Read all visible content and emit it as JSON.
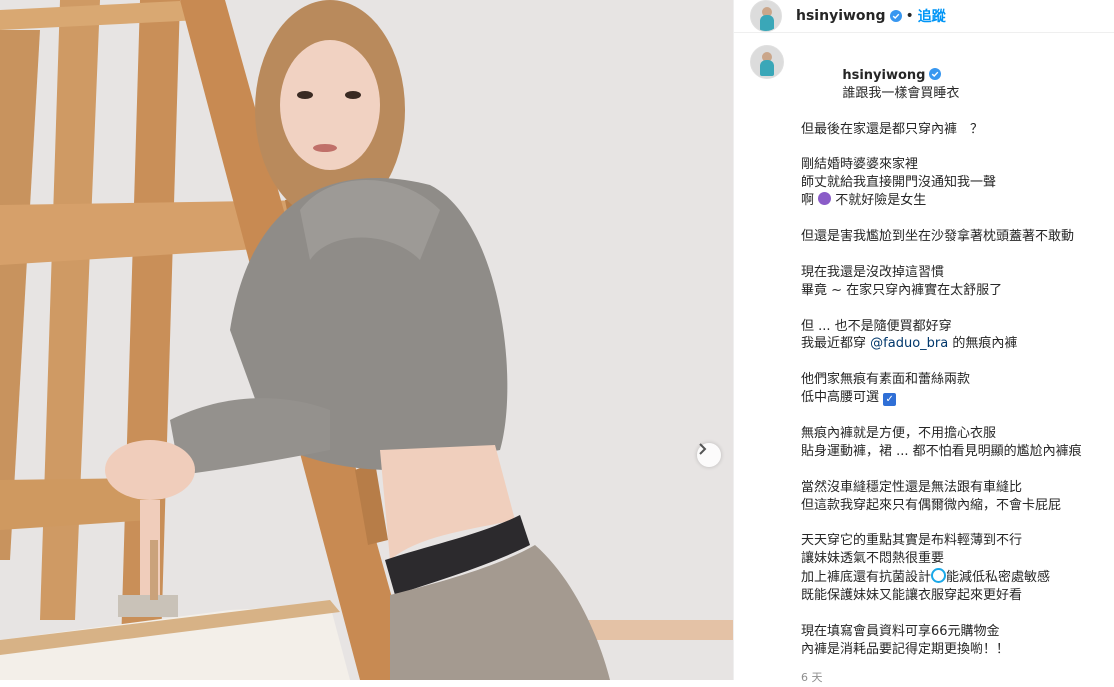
{
  "header": {
    "username": "hsinyiwong",
    "separator": "•",
    "follow_label": "追蹤"
  },
  "caption": {
    "username": "hsinyiwong",
    "first_line": "誰跟我一樣會買睡衣",
    "lines": [
      "但最後在家還是都只穿內褲　？",
      "",
      "剛結婚時婆婆來家裡",
      "師丈就給我直接開門沒通知我一聲",
      "啊",
      "",
      "但還是害我尷尬到坐在沙發拿著枕頭蓋著不敢動",
      "",
      "現在我還是沒改掉這習慣",
      "畢竟 ~ 在家只穿內褲實在太舒服了",
      "",
      "但 ... 也不是隨便買都好穿",
      "我最近都穿",
      "",
      "他們家無痕有素面和蕾絲兩款",
      "低中高腰可選",
      "",
      "無痕內褲就是方便，不用擔心衣服",
      "貼身運動褲，裙 ... 都不怕看見明顯的尷尬內褲痕",
      "",
      "當然沒車縫穩定性還是無法跟有車縫比",
      "但這款我穿起來只有偶爾微內縮，不會卡屁屁",
      "",
      "天天穿它的重點其實是布料輕薄到不行",
      "讓妹妹透氣不悶熱很重要",
      "加上褲底還有抗菌設計",
      "既能保護妹妹又能讓衣服穿起來更好看",
      "",
      "現在填寫會員資料可享66元購物金",
      "內褲是消耗品要記得定期更換喲！！"
    ],
    "ah_suffix": "不就好險是女生",
    "mention": "@faduo_bra",
    "mention_suffix": " 的無痕內褲",
    "antibac_suffix": "能減低私密處敏感",
    "check_emoji": "✓",
    "timestamp": "6 天"
  },
  "icons": {
    "verified": "verified-badge-icon",
    "next": "chevron-right-icon"
  },
  "colors": {
    "link": "#0095f6",
    "mention": "#00376b",
    "verified": "#3897f0"
  }
}
